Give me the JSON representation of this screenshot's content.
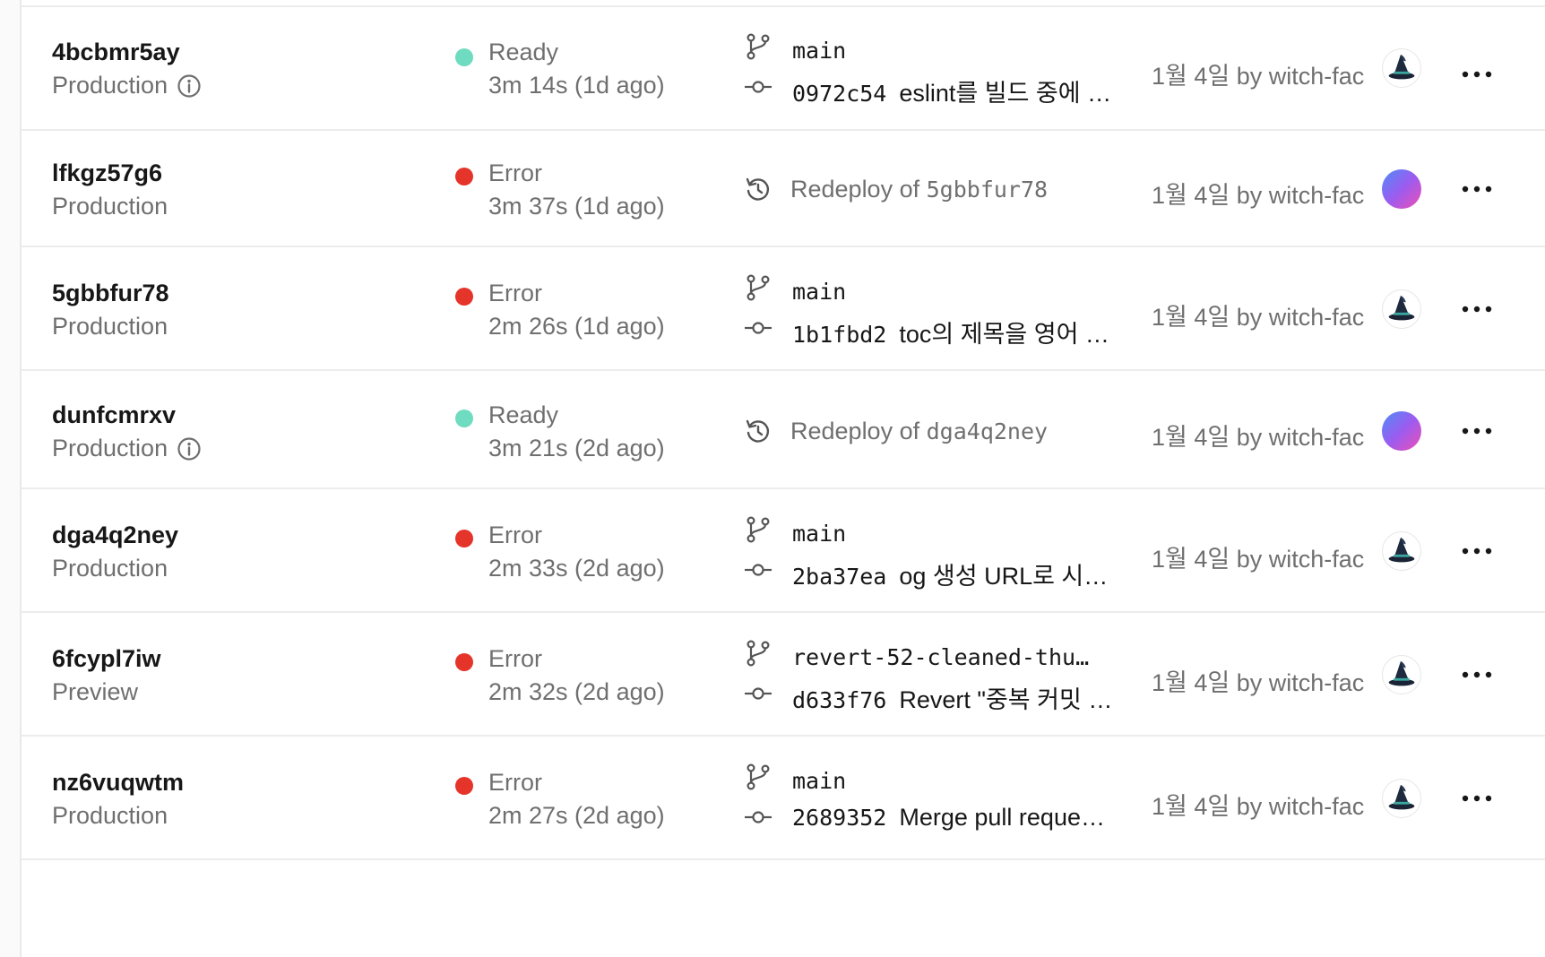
{
  "deployments": [
    {
      "id": "4bcbmr5ay",
      "environment": "Production",
      "has_info": true,
      "status": "Ready",
      "status_color": "#6fdbc0",
      "duration": "3m 14s (1d ago)",
      "source_type": "commit",
      "branch": "main",
      "commit_sha": "0972c54",
      "commit_message": "eslint를 빌드 중에 …",
      "date_by": "1월 4일 by witch-fac",
      "avatar": "witch-hat-avatar"
    },
    {
      "id": "lfkgz57g6",
      "environment": "Production",
      "has_info": false,
      "status": "Error",
      "status_color": "#e5342a",
      "duration": "3m 37s (1d ago)",
      "source_type": "redeploy",
      "redeploy_prefix": "Redeploy of",
      "redeploy_of": "5gbbfur78",
      "date_by": "1월 4일 by witch-fac",
      "avatar": "gradient-avatar"
    },
    {
      "id": "5gbbfur78",
      "environment": "Production",
      "has_info": false,
      "status": "Error",
      "status_color": "#e5342a",
      "duration": "2m 26s (1d ago)",
      "source_type": "commit",
      "branch": "main",
      "commit_sha": "1b1fbd2",
      "commit_message": "toc의 제목을 영어 …",
      "date_by": "1월 4일 by witch-fac",
      "avatar": "witch-hat-avatar"
    },
    {
      "id": "dunfcmrxv",
      "environment": "Production",
      "has_info": true,
      "status": "Ready",
      "status_color": "#6fdbc0",
      "duration": "3m 21s (2d ago)",
      "source_type": "redeploy",
      "redeploy_prefix": "Redeploy of",
      "redeploy_of": "dga4q2ney",
      "date_by": "1월 4일 by witch-fac",
      "avatar": "gradient-avatar"
    },
    {
      "id": "dga4q2ney",
      "environment": "Production",
      "has_info": false,
      "status": "Error",
      "status_color": "#e5342a",
      "duration": "2m 33s (2d ago)",
      "source_type": "commit",
      "branch": "main",
      "commit_sha": "2ba37ea",
      "commit_message": "og 생성 URL로 시…",
      "date_by": "1월 4일 by witch-fac",
      "avatar": "witch-hat-avatar"
    },
    {
      "id": "6fcypl7iw",
      "environment": "Preview",
      "has_info": false,
      "status": "Error",
      "status_color": "#e5342a",
      "duration": "2m 32s (2d ago)",
      "source_type": "commit",
      "branch": "revert-52-cleaned-thu…",
      "commit_sha": "d633f76",
      "commit_message": "Revert \"중복 커밋 …",
      "date_by": "1월 4일 by witch-fac",
      "avatar": "witch-hat-avatar"
    },
    {
      "id": "nz6vuqwtm",
      "environment": "Production",
      "has_info": false,
      "status": "Error",
      "status_color": "#e5342a",
      "duration": "2m 27s (2d ago)",
      "source_type": "commit",
      "branch": "main",
      "commit_sha": "2689352",
      "commit_message": "Merge pull reque…",
      "date_by": "1월 4일 by witch-fac",
      "avatar": "witch-hat-avatar"
    }
  ]
}
